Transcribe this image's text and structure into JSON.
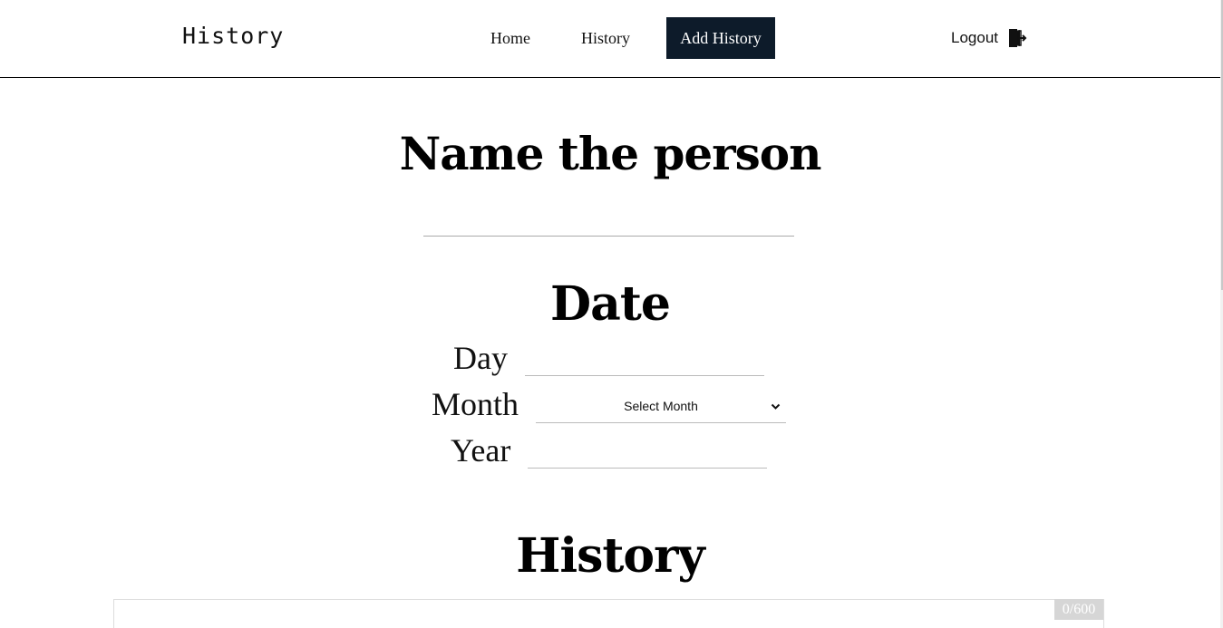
{
  "nav": {
    "brand": "History",
    "links": [
      {
        "label": "Home"
      },
      {
        "label": "History"
      },
      {
        "label": "Add History",
        "active": true
      }
    ],
    "logout_label": "Logout",
    "logout_icon": "logout-icon",
    "active_bg": "#0d1b2a"
  },
  "form": {
    "name_heading": "Name the person",
    "name_value": "",
    "date_heading": "Date",
    "day_label": "Day",
    "day_value": "",
    "month_label": "Month",
    "month_selected": "Select Month",
    "year_label": "Year",
    "year_value": "",
    "history_heading": "History",
    "history_value": "",
    "char_counter": "0/600"
  }
}
